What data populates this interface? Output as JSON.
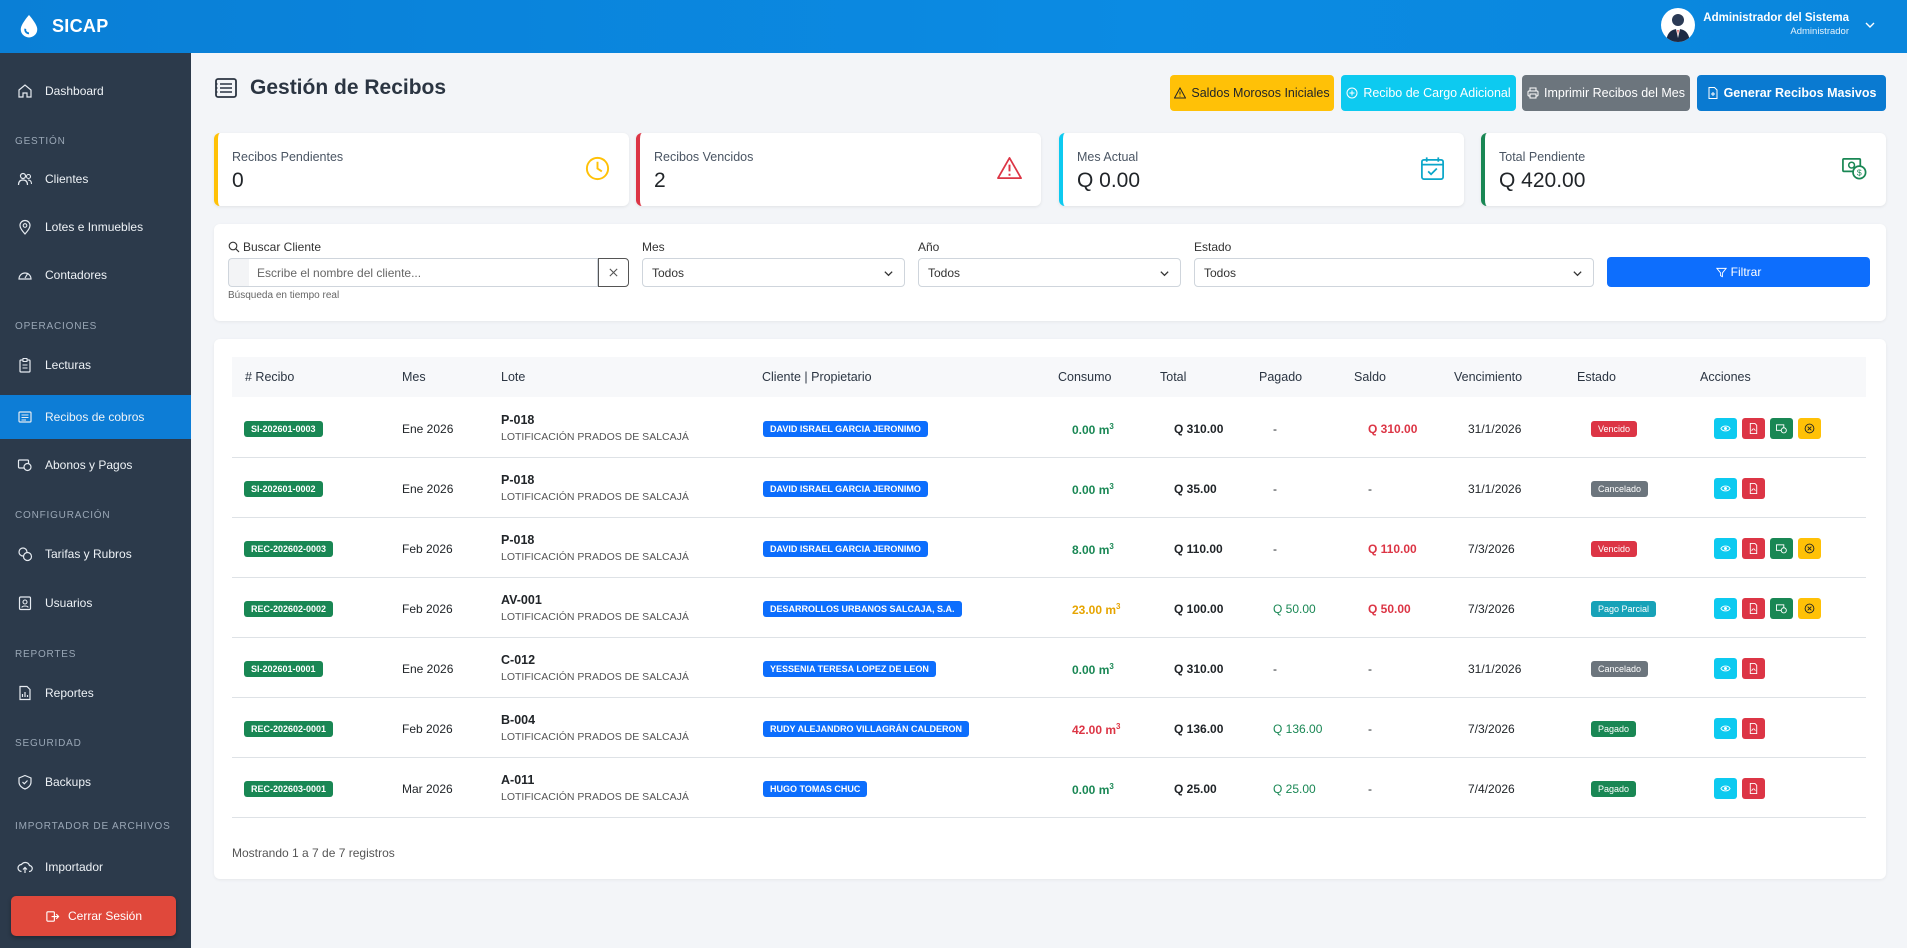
{
  "app": {
    "brand": "SICAP"
  },
  "user": {
    "name": "Administrador del Sistema",
    "role": "Administrador"
  },
  "sidebar": {
    "sections": {
      "gestion": "GESTIÓN",
      "operaciones": "OPERACIONES",
      "configuracion": "CONFIGURACIÓN",
      "reportes": "REPORTES",
      "seguridad": "SEGURIDAD",
      "importador": "IMPORTADOR DE ARCHIVOS"
    },
    "items": {
      "dashboard": "Dashboard",
      "clientes": "Clientes",
      "lotes": "Lotes e Inmuebles",
      "contadores": "Contadores",
      "lecturas": "Lecturas",
      "recibos": "Recibos de cobros",
      "abonos": "Abonos y Pagos",
      "tarifas": "Tarifas y Rubros",
      "usuarios": "Usuarios",
      "reportes": "Reportes",
      "backups": "Backups",
      "importador": "Importador"
    },
    "logout": "Cerrar Sesión"
  },
  "page": {
    "title": "Gestión de Recibos"
  },
  "actions": {
    "saldos": "Saldos Morosos Iniciales",
    "cargo": "Recibo de Cargo Adicional",
    "imprimir": "Imprimir Recibos del Mes",
    "generar": "Generar Recibos Masivos"
  },
  "cards": {
    "pendientes": {
      "label": "Recibos Pendientes",
      "value": "0"
    },
    "vencidos": {
      "label": "Recibos Vencidos",
      "value": "2"
    },
    "mes": {
      "label": "Mes Actual",
      "value": "Q 0.00"
    },
    "total": {
      "label": "Total Pendiente",
      "value": "Q 420.00"
    }
  },
  "filters": {
    "search_label": "Buscar Cliente",
    "search_placeholder": "Escribe el nombre del cliente...",
    "search_hint": "Búsqueda en tiempo real",
    "mes_label": "Mes",
    "mes_value": "Todos",
    "anio_label": "Año",
    "anio_value": "Todos",
    "estado_label": "Estado",
    "estado_value": "Todos",
    "filter_button": "Filtrar"
  },
  "table": {
    "headers": {
      "recibo": "# Recibo",
      "mes": "Mes",
      "lote": "Lote",
      "cliente": "Cliente | Propietario",
      "consumo": "Consumo",
      "total": "Total",
      "pagado": "Pagado",
      "saldo": "Saldo",
      "vencimiento": "Vencimiento",
      "estado": "Estado",
      "acciones": "Acciones"
    },
    "rows": [
      {
        "recibo": "SI-202601-0003",
        "mes": "Ene 2026",
        "lote": "P-018",
        "lote_sub": "LOTIFICACIÓN PRADOS DE SALCAJÁ",
        "cliente": "DAVID ISRAEL GARCIA JERONIMO",
        "consumo": "0.00 m",
        "total": "Q 310.00",
        "pagado": "-",
        "saldo": "Q 310.00",
        "vencimiento": "31/1/2026",
        "estado": "Vencido"
      },
      {
        "recibo": "SI-202601-0002",
        "mes": "Ene 2026",
        "lote": "P-018",
        "lote_sub": "LOTIFICACIÓN PRADOS DE SALCAJÁ",
        "cliente": "DAVID ISRAEL GARCIA JERONIMO",
        "consumo": "0.00 m",
        "total": "Q 35.00",
        "pagado": "-",
        "saldo": "-",
        "vencimiento": "31/1/2026",
        "estado": "Cancelado"
      },
      {
        "recibo": "REC-202602-0003",
        "mes": "Feb 2026",
        "lote": "P-018",
        "lote_sub": "LOTIFICACIÓN PRADOS DE SALCAJÁ",
        "cliente": "DAVID ISRAEL GARCIA JERONIMO",
        "consumo": "8.00 m",
        "total": "Q 110.00",
        "pagado": "-",
        "saldo": "Q 110.00",
        "vencimiento": "7/3/2026",
        "estado": "Vencido"
      },
      {
        "recibo": "REC-202602-0002",
        "mes": "Feb 2026",
        "lote": "AV-001",
        "lote_sub": "LOTIFICACIÓN PRADOS DE SALCAJÁ",
        "cliente": "DESARROLLOS URBANOS SALCAJA, S.A.",
        "consumo": "23.00 m",
        "total": "Q 100.00",
        "pagado": "Q 50.00",
        "saldo": "Q 50.00",
        "vencimiento": "7/3/2026",
        "estado": "Pago Parcial"
      },
      {
        "recibo": "SI-202601-0001",
        "mes": "Ene 2026",
        "lote": "C-012",
        "lote_sub": "LOTIFICACIÓN PRADOS DE SALCAJÁ",
        "cliente": "YESSENIA TERESA LOPEZ DE LEON",
        "consumo": "0.00 m",
        "total": "Q 310.00",
        "pagado": "-",
        "saldo": "-",
        "vencimiento": "31/1/2026",
        "estado": "Cancelado"
      },
      {
        "recibo": "REC-202602-0001",
        "mes": "Feb 2026",
        "lote": "B-004",
        "lote_sub": "LOTIFICACIÓN PRADOS DE SALCAJÁ",
        "cliente": "RUDY ALEJANDRO VILLAGRÁN CALDERON",
        "consumo": "42.00 m",
        "total": "Q 136.00",
        "pagado": "Q 136.00",
        "saldo": "-",
        "vencimiento": "7/3/2026",
        "estado": "Pagado"
      },
      {
        "recibo": "REC-202603-0001",
        "mes": "Mar 2026",
        "lote": "A-011",
        "lote_sub": "LOTIFICACIÓN PRADOS DE SALCAJÁ",
        "cliente": "HUGO TOMAS CHUC",
        "consumo": "0.00 m",
        "total": "Q 25.00",
        "pagado": "Q 25.00",
        "saldo": "-",
        "vencimiento": "7/4/2026",
        "estado": "Pagado"
      }
    ],
    "footer": "Mostrando 1 a 7 de 7 registros"
  }
}
